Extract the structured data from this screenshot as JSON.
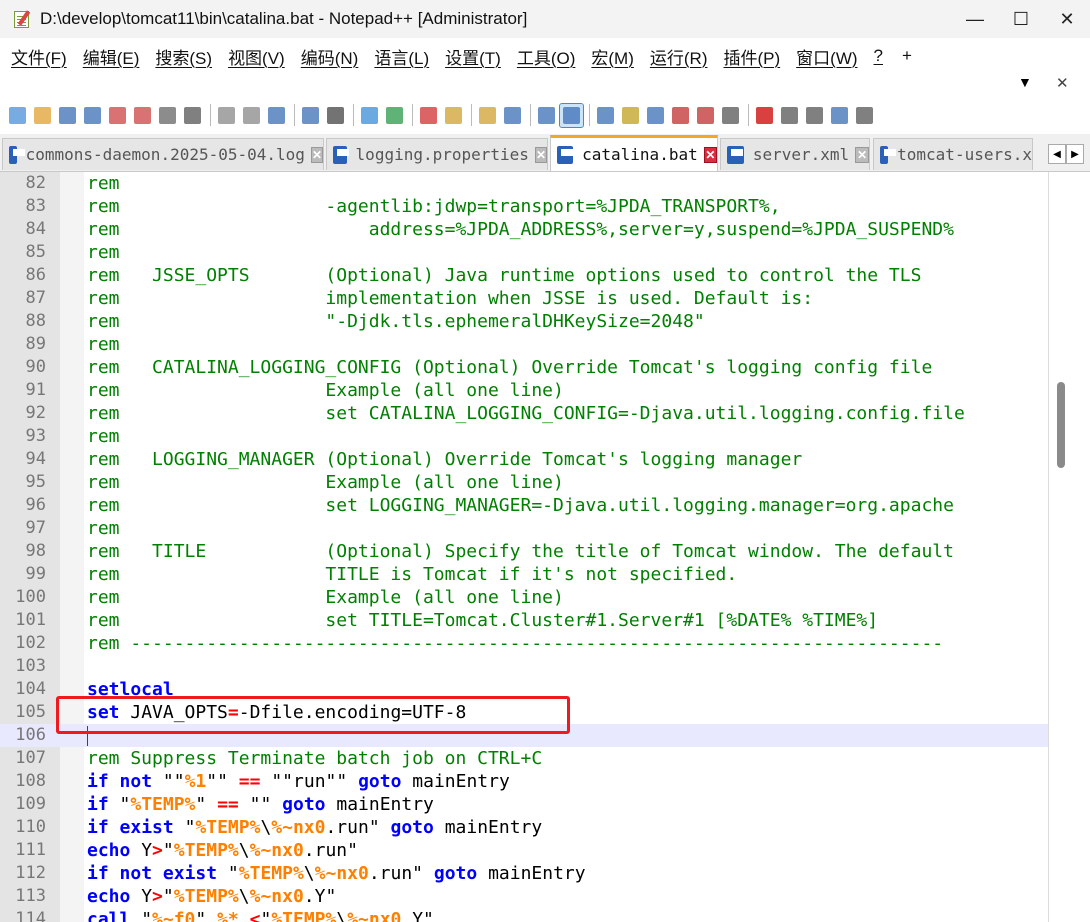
{
  "window": {
    "title": "D:\\develop\\tomcat11\\bin\\catalina.bat - Notepad++ [Administrator]",
    "minimize_glyph": "—",
    "maximize_glyph": "☐",
    "close_glyph": "✕"
  },
  "menu": {
    "items": [
      "文件(F)",
      "编辑(E)",
      "搜索(S)",
      "视图(V)",
      "编码(N)",
      "语言(L)",
      "设置(T)",
      "工具(O)",
      "宏(M)",
      "运行(R)",
      "插件(P)",
      "窗口(W)",
      "?"
    ],
    "plus": "+",
    "dropdown_glyph": "▼",
    "close_glyph": "✕"
  },
  "tabs": [
    {
      "label": "commons-daemon.2025-05-04.log",
      "active": false
    },
    {
      "label": "logging.properties",
      "active": false
    },
    {
      "label": "catalina.bat",
      "active": true
    },
    {
      "label": "server.xml",
      "active": false
    },
    {
      "label": "tomcat-users.x",
      "active": false
    }
  ],
  "tab_close_glyph": "✕",
  "tab_scroll": {
    "left": "◀",
    "right": "▶"
  },
  "toolbar": {
    "colors": [
      "#4a90d9",
      "#e0a030",
      "#3b6fb6",
      "#3b6fb6",
      "#cc4444",
      "#cc4444",
      "#666666",
      "#555555",
      "#888888",
      "#888888",
      "#3b6fb6",
      "#3b6fb6",
      "#444444",
      "#3a8ed6",
      "#2a9a4a",
      "#d03030",
      "#d0a030",
      "#d0a030",
      "#3b6fb6",
      "#3b6fb6",
      "#3b6fb6",
      "#3b6fb6",
      "#c0a020",
      "#3b6fb6",
      "#c03030",
      "#c03030",
      "#555555",
      "#cc0000",
      "#555555",
      "#555555",
      "#3b6fb6",
      "#555555"
    ]
  },
  "editor": {
    "lines": [
      {
        "n": "82",
        "t": "rem"
      },
      {
        "n": "83",
        "t": "rem                   -agentlib:jdwp=transport=%JPDA_TRANSPORT%,"
      },
      {
        "n": "84",
        "t": "rem                       address=%JPDA_ADDRESS%,server=y,suspend=%JPDA_SUSPEND%"
      },
      {
        "n": "85",
        "t": "rem"
      },
      {
        "n": "86",
        "t": "rem   JSSE_OPTS       (Optional) Java runtime options used to control the TLS"
      },
      {
        "n": "87",
        "t": "rem                   implementation when JSSE is used. Default is:"
      },
      {
        "n": "88",
        "t": "rem                   \"-Djdk.tls.ephemeralDHKeySize=2048\""
      },
      {
        "n": "89",
        "t": "rem"
      },
      {
        "n": "90",
        "t": "rem   CATALINA_LOGGING_CONFIG (Optional) Override Tomcat's logging config file"
      },
      {
        "n": "91",
        "t": "rem                   Example (all one line)"
      },
      {
        "n": "92",
        "t": "rem                   set CATALINA_LOGGING_CONFIG=-Djava.util.logging.config.file"
      },
      {
        "n": "93",
        "t": "rem"
      },
      {
        "n": "94",
        "t": "rem   LOGGING_MANAGER (Optional) Override Tomcat's logging manager"
      },
      {
        "n": "95",
        "t": "rem                   Example (all one line)"
      },
      {
        "n": "96",
        "t": "rem                   set LOGGING_MANAGER=-Djava.util.logging.manager=org.apache"
      },
      {
        "n": "97",
        "t": "rem"
      },
      {
        "n": "98",
        "t": "rem   TITLE           (Optional) Specify the title of Tomcat window. The default"
      },
      {
        "n": "99",
        "t": "rem                   TITLE is Tomcat if it's not specified."
      },
      {
        "n": "100",
        "t": "rem                   Example (all one line)"
      },
      {
        "n": "101",
        "t": "rem                   set TITLE=Tomcat.Cluster#1.Server#1 [%DATE% %TIME%]"
      },
      {
        "n": "102",
        "t": "rem ---------------------------------------------------------------------------"
      },
      {
        "n": "103",
        "t": ""
      },
      {
        "n": "104",
        "t": "setlocal"
      },
      {
        "n": "105",
        "t": "set JAVA_OPTS=-Dfile.encoding=UTF-8"
      },
      {
        "n": "106",
        "t": ""
      },
      {
        "n": "107",
        "t": "rem Suppress Terminate batch job on CTRL+C"
      },
      {
        "n": "108",
        "t": "if not \"\"%1\"\" == \"\"run\"\" goto mainEntry"
      },
      {
        "n": "109",
        "t": "if \"%TEMP%\" == \"\" goto mainEntry"
      },
      {
        "n": "110",
        "t": "if exist \"%TEMP%\\%~nx0.run\" goto mainEntry"
      },
      {
        "n": "111",
        "t": "echo Y>\"%TEMP%\\%~nx0.run\""
      },
      {
        "n": "112",
        "t": "if not exist \"%TEMP%\\%~nx0.run\" goto mainEntry"
      },
      {
        "n": "113",
        "t": "echo Y>\"%TEMP%\\%~nx0.Y\""
      },
      {
        "n": "114",
        "t": "call \"%~f0\" %* <\"%TEMP%\\%~nx0.Y\""
      }
    ],
    "current_line": "106",
    "highlighted_line": "105"
  }
}
